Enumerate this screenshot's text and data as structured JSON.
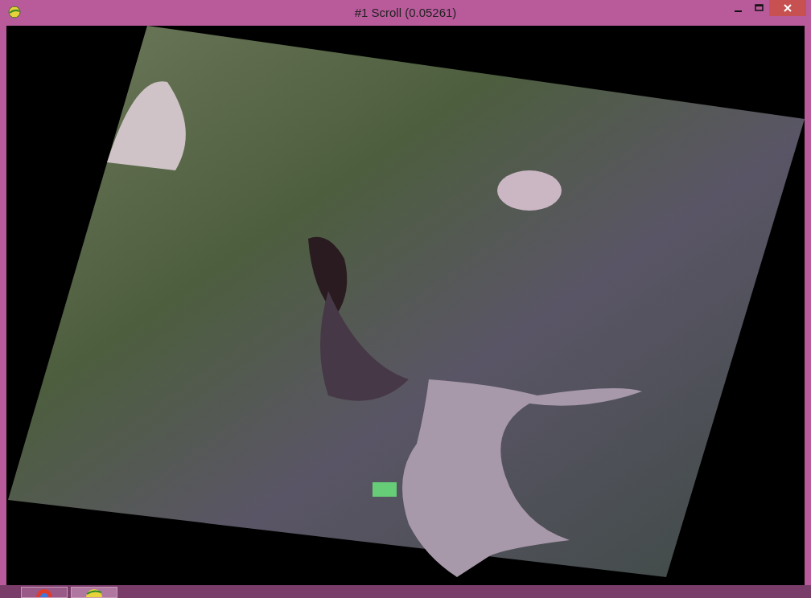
{
  "window": {
    "title": "#1 Scroll (0.05261)"
  }
}
